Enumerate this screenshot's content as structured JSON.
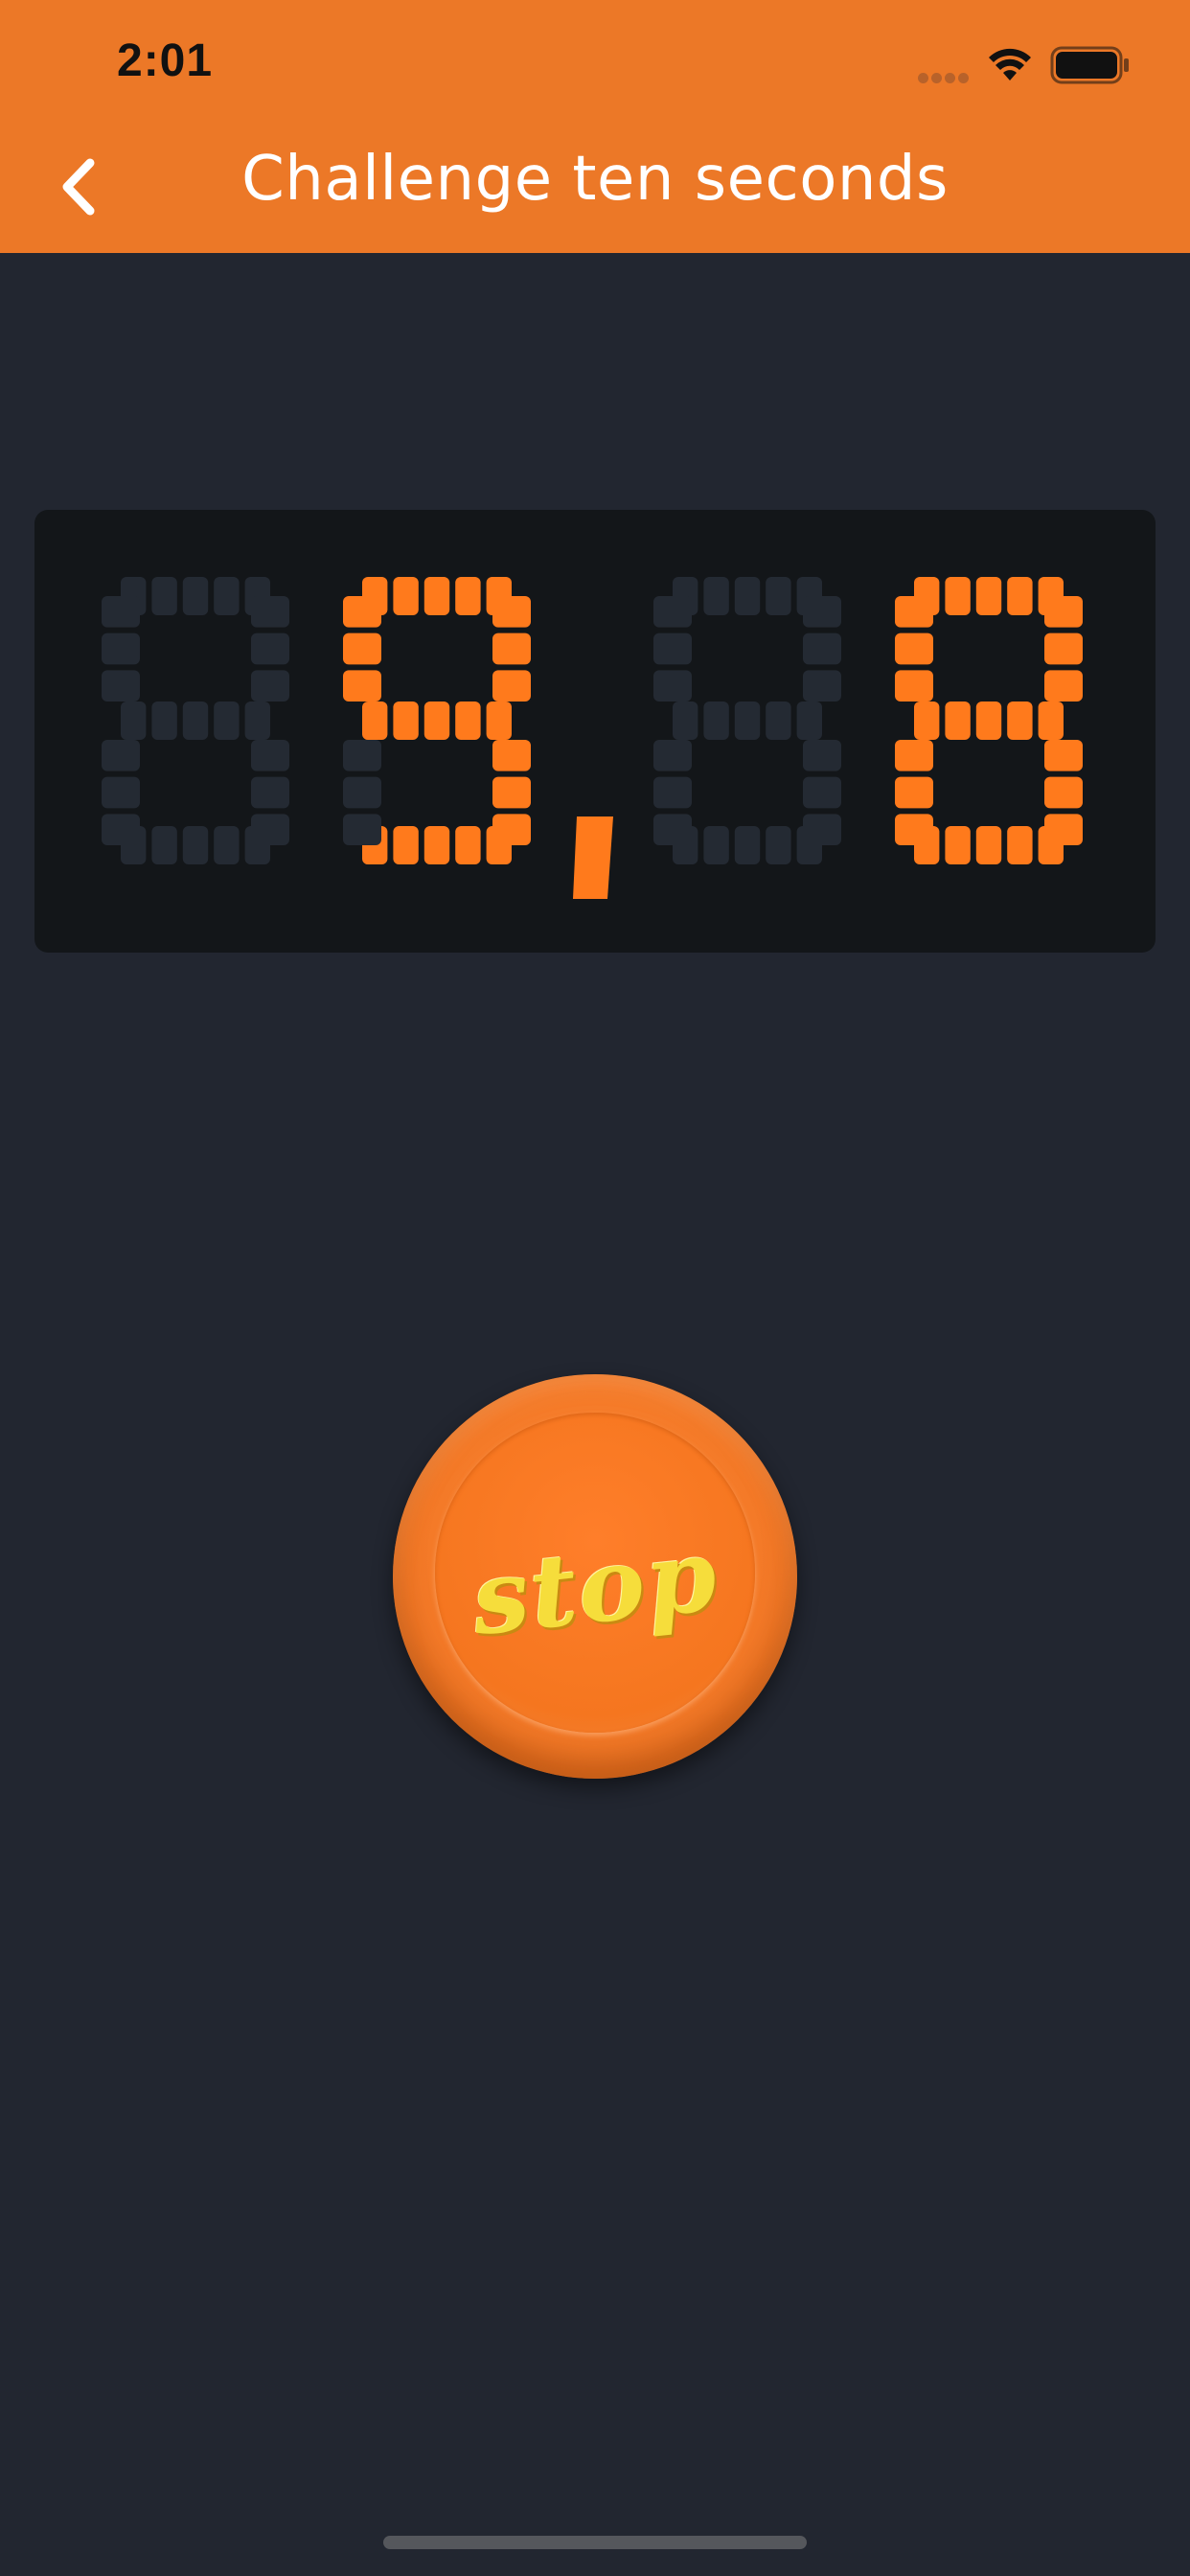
{
  "status_bar": {
    "time": "2:01"
  },
  "nav": {
    "title": "Challenge ten seconds",
    "back_icon": "chevron-left-icon"
  },
  "timer": {
    "digits": [
      "",
      "9",
      "",
      "8"
    ],
    "separator": ",",
    "lit_color": "#ff7a1c",
    "unlit_color": "#242a33",
    "panel_color": "#131619"
  },
  "stop_button": {
    "label": "stop",
    "color": "#f47a28",
    "label_color": "#f6dd3b"
  },
  "colors": {
    "header": "#ec7827",
    "background": "#222630"
  }
}
